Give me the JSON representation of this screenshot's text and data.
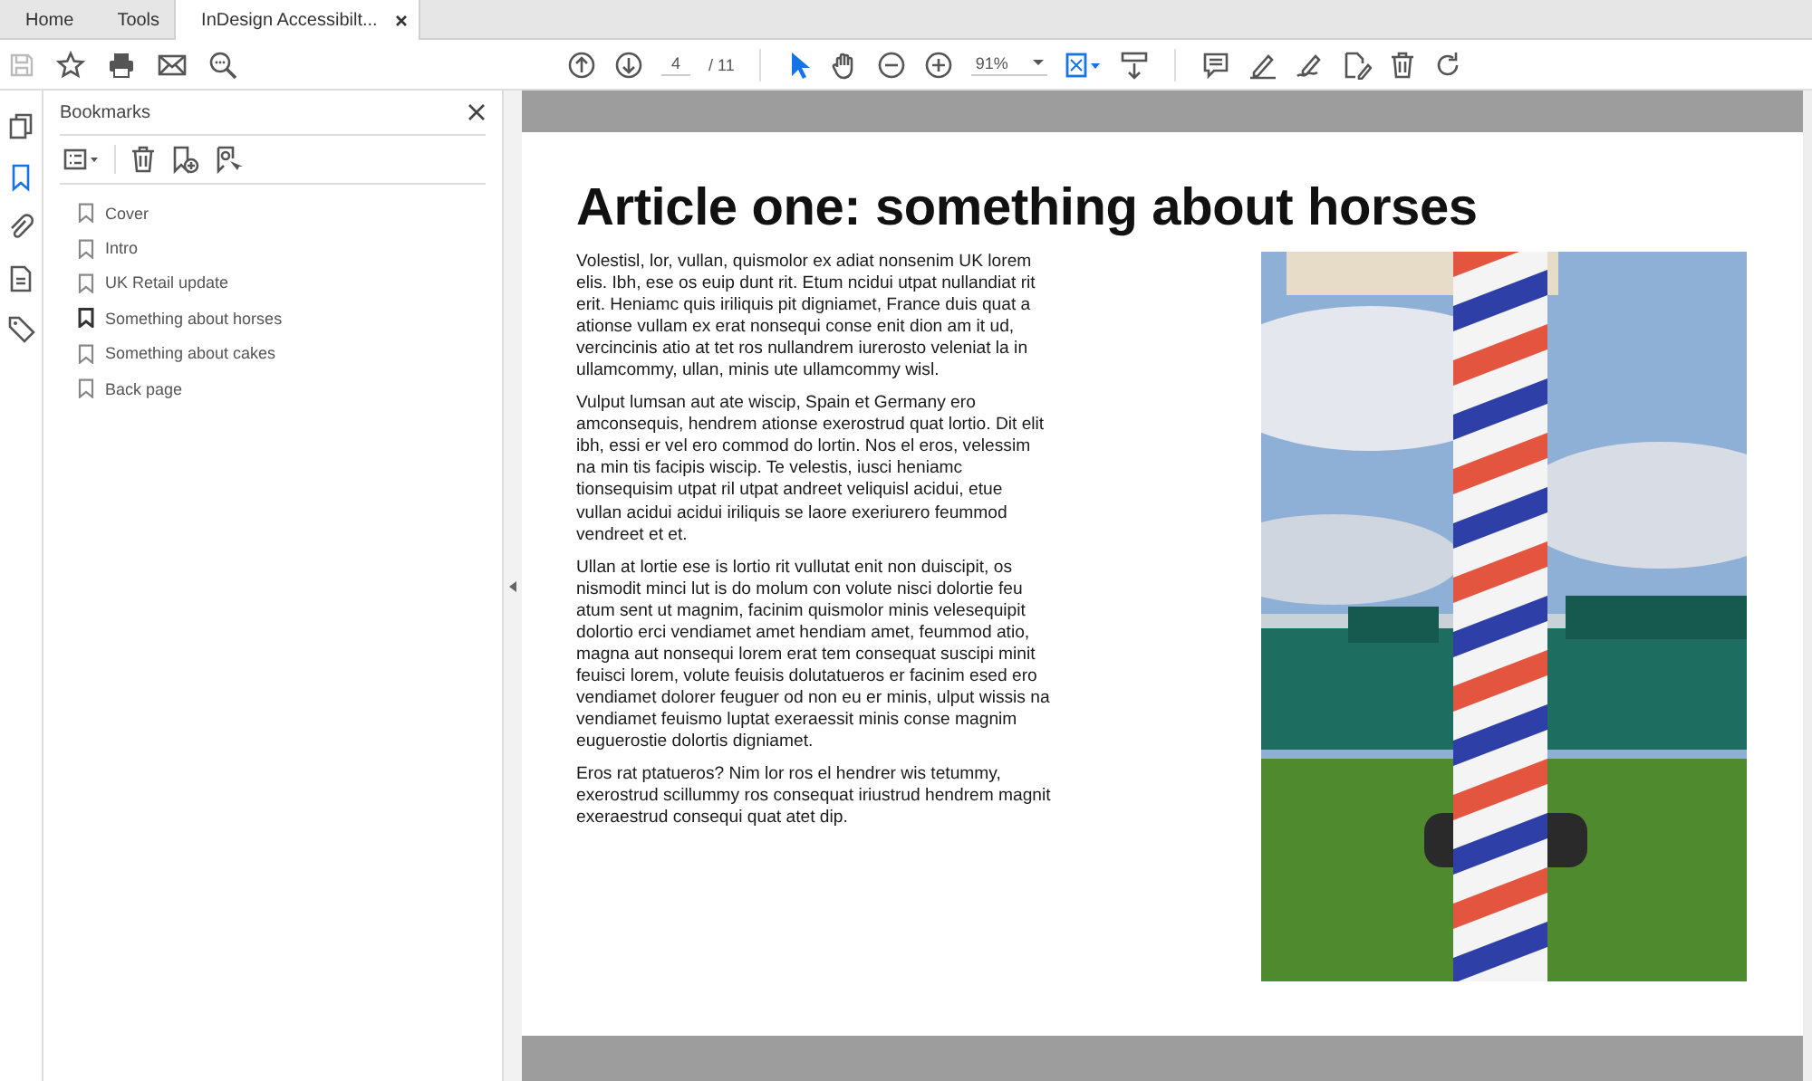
{
  "tabs": [
    {
      "label": "Home",
      "selected": false
    },
    {
      "label": "Tools",
      "selected": false
    },
    {
      "label": "InDesign Accessibilt...",
      "selected": true,
      "closable": true
    }
  ],
  "toolbar": {
    "page": "4",
    "page_total": "/ 11",
    "zoom": "91%"
  },
  "side_tools": [
    {
      "kind": "pages",
      "selected": false
    },
    {
      "kind": "bookmarks",
      "selected": true
    },
    {
      "kind": "attachments",
      "selected": false
    },
    {
      "kind": "document",
      "selected": false
    },
    {
      "kind": "tags",
      "selected": false
    }
  ],
  "bookmarks": {
    "title": "Bookmarks",
    "items": [
      {
        "label": "Cover",
        "selected": false
      },
      {
        "label": "Intro",
        "selected": false
      },
      {
        "label": "UK Retail update",
        "selected": false
      },
      {
        "label": "Something about horses",
        "selected": true
      },
      {
        "label": "Something about cakes",
        "selected": false
      },
      {
        "label": "Back page",
        "selected": false
      }
    ]
  },
  "document": {
    "title": "Article one: something about horses",
    "paragraphs": [
      "Volestisl, lor, vullan, quismolor ex adiat nonsenim UK lorem elis. Ibh, ese os euip dunt rit. Etum ncidui utpat nullandiat rit erit. Heniamc quis iriliquis pit digniamet, France duis quat a ationse vullam ex erat nonsequi conse enit dion am it ud, vercincinis atio at tet ros nullandrem iurerosto veleniat la in ullamcommy, ullan, minis ute ullamcommy wisl.",
      "Vulput lumsan aut ate wiscip, Spain et Germany ero amconsequis, hendrem ationse exerostrud quat lortio. Dit elit ibh, essi er vel ero commod do lortin. Nos el eros, velessim na min tis facipis wiscip. Te velestis, iusci heniamc tionsequisim utpat ril utpat andreet veliquisl acidui, etue vullan acidui acidui iriliquis se laore exeriurero feummod vendreet et et.",
      "Ullan at lortie ese is lortio rit vullutat enit non duiscipit, os nismodit minci lut is do molum con volute nisci dolortie feu atum sent ut magnim, facinim quismolor minis velesequipit dolortio erci vendiamet amet hendiam amet, feummod atio, magna aut nonsequi lorem erat tem consequat suscipi minit feuisci lorem, volute feuisis dolutatueros er facinim esed ero vendiamet dolorer feuguer od non eu er minis, ulput wissis na vendiamet feuismo luptat exeraessit minis conse magnim euguerostie dolortis digniamet.",
      "Eros rat ptatueros? Nim lor ros el hendrer wis tetummy, exerostrud scillummy ros consequat iriustrud hendrem magnit exeraestrud consequi quat atet dip."
    ],
    "image": {
      "kind": "picture"
    }
  }
}
